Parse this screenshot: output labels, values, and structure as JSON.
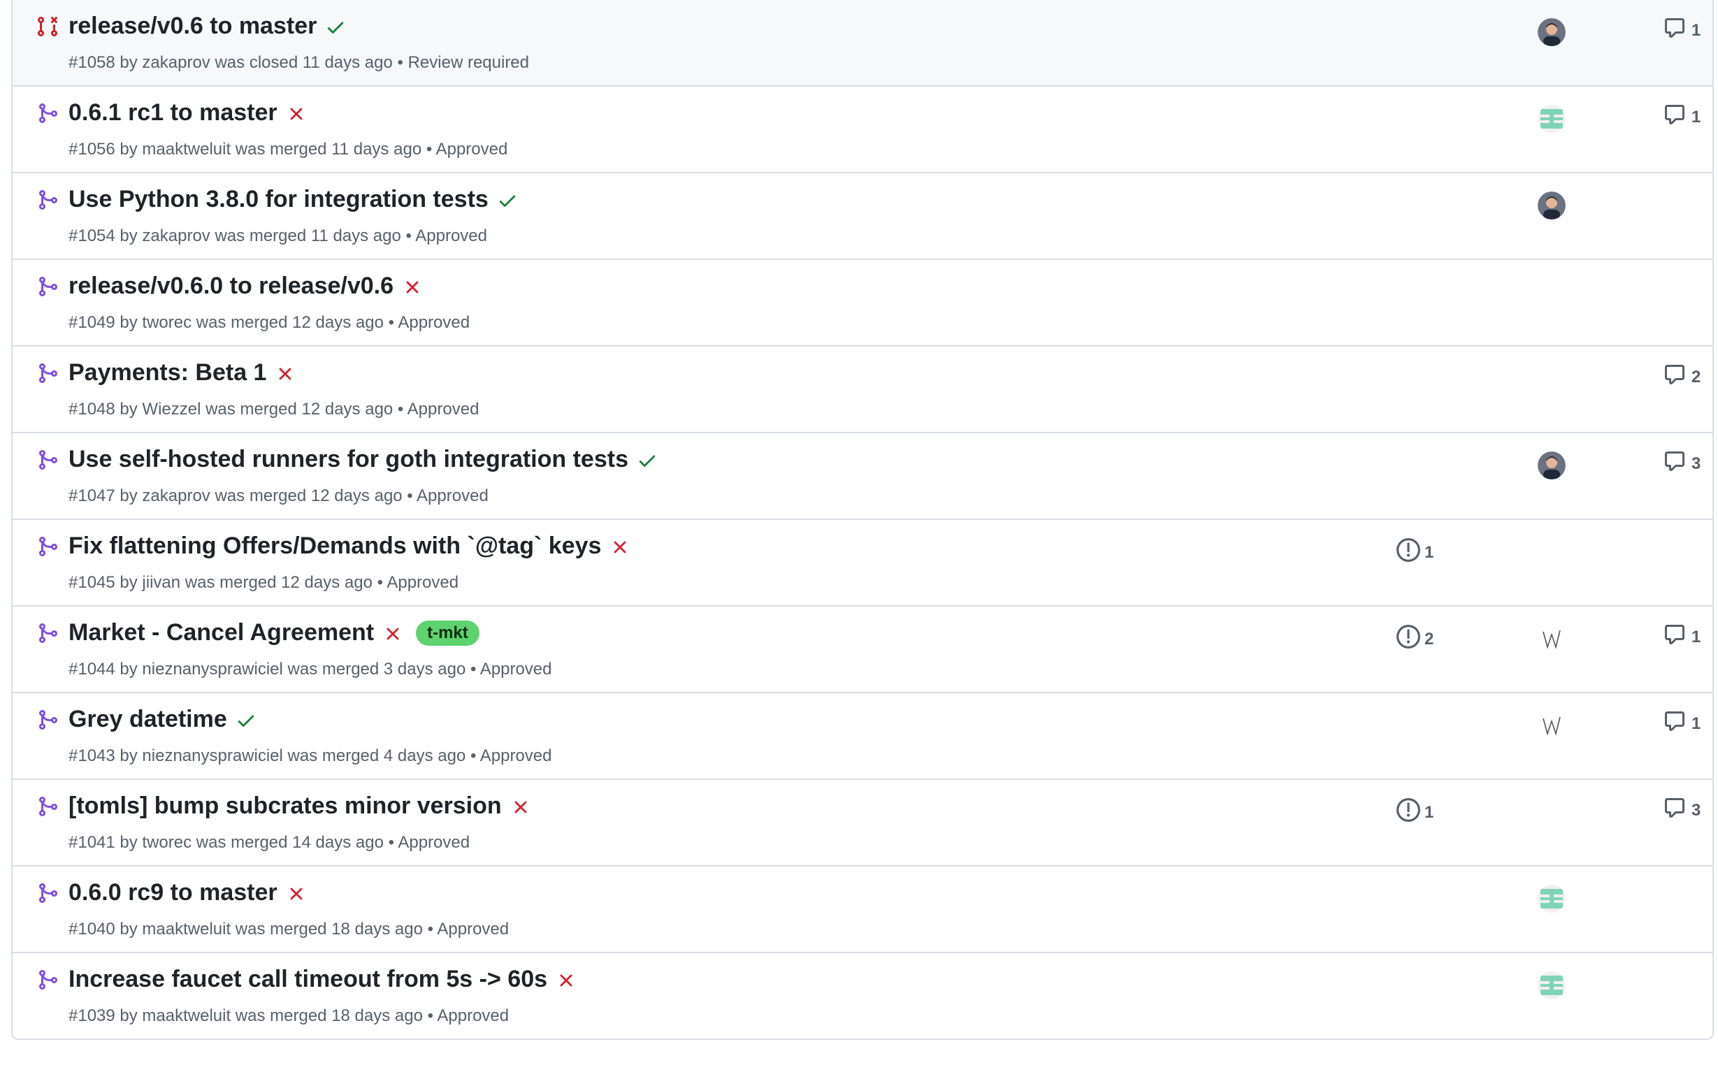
{
  "colors": {
    "merged": "#8250df",
    "closed": "#cf222e",
    "success": "#1a7f37",
    "failure": "#cf222e",
    "label_bg": "#5ed26e",
    "muted": "#57606a",
    "border": "#d8dee4"
  },
  "pulls": [
    {
      "state": "closed",
      "state_icon": "git-pull-request-closed-icon",
      "title": "release/v0.6 to master",
      "status": "success",
      "meta": "#1058 by zakaprov was closed 11 days ago • Review required",
      "avatar": "photo",
      "comments": "1",
      "issues": null,
      "label": null,
      "highlight": true
    },
    {
      "state": "merged",
      "state_icon": "git-merge-icon",
      "title": "0.6.1 rc1 to master",
      "status": "failure",
      "meta": "#1056 by maaktweluit was merged 11 days ago • Approved",
      "avatar": "identicon",
      "comments": "1",
      "issues": null,
      "label": null
    },
    {
      "state": "merged",
      "state_icon": "git-merge-icon",
      "title": "Use Python 3.8.0 for integration tests",
      "status": "success",
      "meta": "#1054 by zakaprov was merged 11 days ago • Approved",
      "avatar": "photo",
      "comments": null,
      "issues": null,
      "label": null
    },
    {
      "state": "merged",
      "state_icon": "git-merge-icon",
      "title": "release/v0.6.0 to release/v0.6",
      "status": "failure",
      "meta": "#1049 by tworec was merged 12 days ago • Approved",
      "avatar": null,
      "comments": null,
      "issues": null,
      "label": null
    },
    {
      "state": "merged",
      "state_icon": "git-merge-icon",
      "title": "Payments: Beta 1",
      "status": "failure",
      "meta": "#1048 by Wiezzel was merged 12 days ago • Approved",
      "avatar": null,
      "comments": "2",
      "issues": null,
      "label": null
    },
    {
      "state": "merged",
      "state_icon": "git-merge-icon",
      "title": "Use self-hosted runners for goth integration tests",
      "status": "success",
      "meta": "#1047 by zakaprov was merged 12 days ago • Approved",
      "avatar": "photo",
      "comments": "3",
      "issues": null,
      "label": null
    },
    {
      "state": "merged",
      "state_icon": "git-merge-icon",
      "title": "Fix flattening Offers/Demands with `@tag` keys",
      "status": "failure",
      "meta": "#1045 by jiivan was merged 12 days ago • Approved",
      "avatar": null,
      "comments": null,
      "issues": "1",
      "label": null
    },
    {
      "state": "merged",
      "state_icon": "git-merge-icon",
      "title": "Market - Cancel Agreement",
      "status": "failure",
      "meta": "#1044 by nieznanysprawiciel was merged 3 days ago • Approved",
      "avatar": "sketch",
      "comments": "1",
      "issues": "2",
      "label": "t-mkt"
    },
    {
      "state": "merged",
      "state_icon": "git-merge-icon",
      "title": "Grey datetime",
      "status": "success",
      "meta": "#1043 by nieznanysprawiciel was merged 4 days ago • Approved",
      "avatar": "sketch",
      "comments": "1",
      "issues": null,
      "label": null
    },
    {
      "state": "merged",
      "state_icon": "git-merge-icon",
      "title": "[tomls] bump subcrates minor version",
      "status": "failure",
      "meta": "#1041 by tworec was merged 14 days ago • Approved",
      "avatar": null,
      "comments": "3",
      "issues": "1",
      "label": null
    },
    {
      "state": "merged",
      "state_icon": "git-merge-icon",
      "title": "0.6.0 rc9 to master",
      "status": "failure",
      "meta": "#1040 by maaktweluit was merged 18 days ago • Approved",
      "avatar": "identicon",
      "comments": null,
      "issues": null,
      "label": null
    },
    {
      "state": "merged",
      "state_icon": "git-merge-icon",
      "title": "Increase faucet call timeout from 5s -> 60s",
      "status": "failure",
      "meta": "#1039 by maaktweluit was merged 18 days ago • Approved",
      "avatar": "identicon",
      "comments": null,
      "issues": null,
      "label": null
    }
  ]
}
